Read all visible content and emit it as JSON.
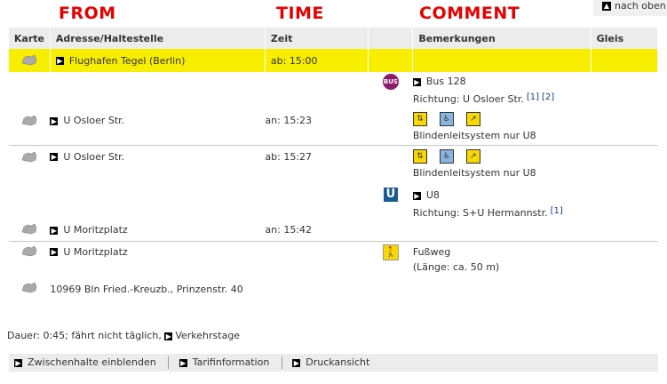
{
  "annotations": {
    "from": "FROM",
    "time": "TIME",
    "comment": "COMMENT"
  },
  "top_link": {
    "label": "nach oben"
  },
  "headers": {
    "map": "Karte",
    "address": "Adresse/Haltestelle",
    "time": "Zeit",
    "remarks": "Bemerkungen",
    "track": "Gleis"
  },
  "rows": [
    {
      "address": "Flughafen Tegel (Berlin)",
      "time": "ab: 15:00"
    },
    {
      "line": "Bus 128",
      "direction": "Richtung: U Osloer Str.",
      "footnotes": [
        "[1]",
        "[2]"
      ]
    },
    {
      "address": "U Osloer Str.",
      "time": "an: 15:23",
      "note": "Blindenleitsystem nur U8"
    },
    {
      "address": "U Osloer Str.",
      "time": "ab: 15:27",
      "note": "Blindenleitsystem nur U8"
    },
    {
      "line": "U8",
      "direction": "Richtung: S+U Hermannstr.",
      "footnotes": [
        "[1]"
      ]
    },
    {
      "address": "U Moritzplatz",
      "time": "an: 15:42"
    },
    {
      "address": "U Moritzplatz",
      "remark": "Fußweg",
      "remark2": "(Länge: ca. 50 m)"
    },
    {
      "address": "10969 Bln Fried.-Kreuzb., Prinzenstr. 40"
    }
  ],
  "duration": {
    "text": "Dauer: 0:45; fährt nicht täglich,",
    "link": "Verkehrstage"
  },
  "footer": {
    "item1": "Zwischenhalte einblenden",
    "item2": "Tarifinformation",
    "item3": "Druckansicht"
  },
  "icons": {
    "bus": "BUS",
    "ubahn": "U",
    "map": "map-icon",
    "walk": "walk-icon"
  }
}
